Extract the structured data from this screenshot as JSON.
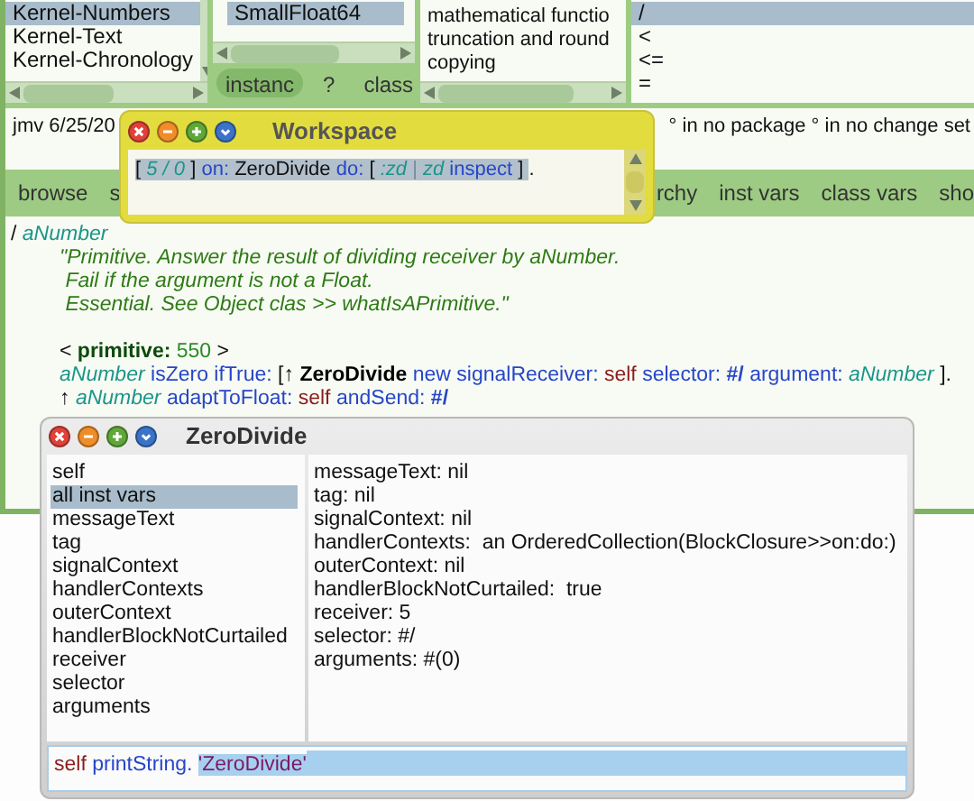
{
  "browser": {
    "category_list": [
      {
        "label": "Kernel-Numbers",
        "selected": true
      },
      {
        "label": "Kernel-Text",
        "selected": false
      },
      {
        "label": "Kernel-Chronology",
        "selected": false
      }
    ],
    "class_list": [
      {
        "label": "SmallFloat64",
        "selected": true
      }
    ],
    "class_toggle": [
      {
        "label": "instanc",
        "selected": true
      },
      {
        "label": "?",
        "selected": false
      },
      {
        "label": "class",
        "selected": false
      }
    ],
    "protocol_list": [
      {
        "label": "mathematical functio",
        "selected": false
      },
      {
        "label": "truncation and round",
        "selected": false
      },
      {
        "label": "copying",
        "selected": false
      }
    ],
    "method_list": [
      {
        "label": "/",
        "selected": true
      },
      {
        "label": "<",
        "selected": false
      },
      {
        "label": "<=",
        "selected": false
      },
      {
        "label": "=",
        "selected": false
      }
    ],
    "info_line": {
      "left": "jmv 6/25/20",
      "right": "° in no package ° in no change set"
    },
    "buttons_left": [
      "browse",
      "s"
    ],
    "buttons_right": [
      "rchy",
      "inst vars",
      "class vars",
      "sho"
    ],
    "code": [
      {
        "kind": "signature",
        "tokens": [
          {
            "text": "/",
            "kind": "plain"
          },
          {
            "text": "aNumber",
            "kind": "arg"
          }
        ]
      },
      {
        "kind": "body",
        "tokens": [
          {
            "text": "\"Primitive. Answer the result of dividing receiver by aNumber.",
            "kind": "comment"
          }
        ]
      },
      {
        "kind": "body",
        "tokens": [
          {
            "text": " Fail if the argument is not a Float.",
            "kind": "comment"
          }
        ]
      },
      {
        "kind": "body",
        "tokens": [
          {
            "text": " Essential. See Object clas >> whatIsAPrimitive.\"",
            "kind": "comment"
          }
        ]
      },
      {
        "kind": "blank"
      },
      {
        "kind": "body",
        "tokens": [
          {
            "text": "<",
            "kind": "plain"
          },
          {
            "text": "primitive:",
            "kind": "pragma"
          },
          {
            "text": "550",
            "kind": "number"
          },
          {
            "text": ">",
            "kind": "plain"
          }
        ]
      },
      {
        "kind": "body",
        "tokens": [
          {
            "text": "aNumber",
            "kind": "arg"
          },
          {
            "text": "isZero",
            "kind": "selector"
          },
          {
            "text": "ifTrue:",
            "kind": "selector"
          },
          {
            "text": "[↑",
            "kind": "plain"
          },
          {
            "text": "ZeroDivide",
            "kind": "bold"
          },
          {
            "text": "new",
            "kind": "selector"
          },
          {
            "text": "signalReceiver:",
            "kind": "selector"
          },
          {
            "text": "self",
            "kind": "self"
          },
          {
            "text": "selector:",
            "kind": "selector"
          },
          {
            "text": "#/",
            "kind": "symbol"
          },
          {
            "text": "argument:",
            "kind": "selector"
          },
          {
            "text": "aNumber",
            "kind": "arg"
          },
          {
            "text": "].",
            "kind": "plain"
          }
        ]
      },
      {
        "kind": "body",
        "tokens": [
          {
            "text": "↑",
            "kind": "plain"
          },
          {
            "text": "aNumber",
            "kind": "arg"
          },
          {
            "text": "adaptToFloat:",
            "kind": "selector"
          },
          {
            "text": "self",
            "kind": "self"
          },
          {
            "text": "andSend:",
            "kind": "selector"
          },
          {
            "text": "#/",
            "kind": "symbol"
          }
        ]
      }
    ]
  },
  "workspace": {
    "title": "Workspace",
    "tokens": [
      {
        "text": "[",
        "kind": "plain",
        "selected": true
      },
      {
        "text": "5 / 0",
        "kind": "arg",
        "selected": true
      },
      {
        "text": "]",
        "kind": "plain",
        "selected": true
      },
      {
        "text": "on:",
        "kind": "selector",
        "selected": true
      },
      {
        "text": "ZeroDivide",
        "kind": "plain",
        "selected": true
      },
      {
        "text": "do:",
        "kind": "selector",
        "selected": true
      },
      {
        "text": "[",
        "kind": "plain",
        "selected": true
      },
      {
        "text": ":zd",
        "kind": "arg",
        "selected": true
      },
      {
        "text": "|",
        "kind": "bar",
        "selected": true
      },
      {
        "text": "zd",
        "kind": "arg",
        "selected": true
      },
      {
        "text": "inspect",
        "kind": "selector",
        "selected": true
      },
      {
        "text": "]",
        "kind": "plain",
        "selected": true
      },
      {
        "text": ".",
        "kind": "plain",
        "selected": false
      }
    ]
  },
  "inspector": {
    "title": "ZeroDivide",
    "fields": [
      {
        "label": "self",
        "selected": false
      },
      {
        "label": "all inst vars",
        "selected": true
      },
      {
        "label": "messageText",
        "selected": false
      },
      {
        "label": "tag",
        "selected": false
      },
      {
        "label": "signalContext",
        "selected": false
      },
      {
        "label": "handlerContexts",
        "selected": false
      },
      {
        "label": "outerContext",
        "selected": false
      },
      {
        "label": "handlerBlockNotCurtailed",
        "selected": false
      },
      {
        "label": "receiver",
        "selected": false
      },
      {
        "label": "selector",
        "selected": false
      },
      {
        "label": "arguments",
        "selected": false
      }
    ],
    "values": [
      "messageText: nil",
      "tag: nil",
      "signalContext: nil",
      "handlerContexts:  an OrderedCollection(BlockClosure>>on:do:)",
      "outerContext: nil",
      "handlerBlockNotCurtailed:  true",
      "receiver: 5",
      "selector: #/",
      "arguments: #(0)"
    ],
    "eval": [
      {
        "text": "self",
        "kind": "self",
        "selected": false
      },
      {
        "text": "printString.",
        "kind": "selector",
        "selected": false
      },
      {
        "text": "'ZeroDivide'",
        "kind": "string",
        "selected": true
      }
    ]
  }
}
